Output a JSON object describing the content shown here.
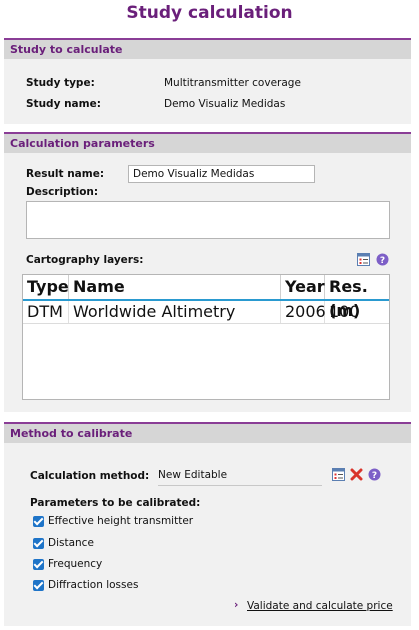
{
  "page": {
    "title": "Study calculation"
  },
  "study_section": {
    "header": "Study to calculate",
    "type_label": "Study type:",
    "type_value": "Multitransmitter coverage",
    "name_label": "Study name:",
    "name_value": "Demo Visualiz Medidas"
  },
  "params_section": {
    "header": "Calculation parameters",
    "result_label": "Result name:",
    "result_value": "Demo Visualiz Medidas",
    "description_label": "Description:",
    "description_value": "",
    "carto_label": "Cartography layers:",
    "icons": [
      "list-select-icon",
      "help-icon"
    ],
    "columns": [
      "Type",
      "Name",
      "Year",
      "Res. (m)"
    ],
    "rows": [
      [
        "DTM",
        "Worldwide Altimetry",
        "2006",
        "100"
      ]
    ]
  },
  "method_section": {
    "header": "Method to calibrate",
    "method_label": "Calculation method:",
    "method_value": "New Editable",
    "icons": [
      "list-select-icon",
      "delete-icon",
      "help-icon"
    ],
    "params_label": "Parameters to be calibrated:",
    "checkboxes": [
      {
        "label": "Effective height transmitter",
        "checked": true
      },
      {
        "label": "Distance",
        "checked": true
      },
      {
        "label": "Frequency",
        "checked": true
      },
      {
        "label": "Diffraction losses",
        "checked": true
      }
    ],
    "link_label": "Validate and calculate price",
    "accent_color": "#6a1f7a",
    "check_color": "#1e74c8"
  }
}
